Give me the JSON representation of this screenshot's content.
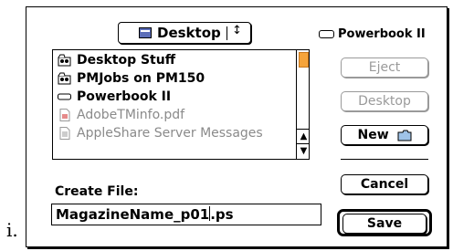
{
  "prefix": "i.",
  "location_popup": {
    "label": "Desktop",
    "arrow": "↕",
    "icon": "desktop-icon"
  },
  "volume": {
    "label": "Powerbook II",
    "icon": "disk-icon"
  },
  "file_list": {
    "items": [
      {
        "label": "Desktop Stuff",
        "icon": "shared-folder-icon",
        "enabled": true
      },
      {
        "label": "PMJobs on PM150",
        "icon": "shared-folder-icon",
        "enabled": true
      },
      {
        "label": "Powerbook II",
        "icon": "disk-icon",
        "enabled": true
      },
      {
        "label": "AdobeTMinfo.pdf",
        "icon": "pdf-document-icon",
        "enabled": false
      },
      {
        "label": "AppleShare Server Messages",
        "icon": "document-icon",
        "enabled": false
      }
    ]
  },
  "buttons": {
    "eject": "Eject",
    "desktop": "Desktop",
    "new": "New",
    "cancel": "Cancel",
    "save": "Save"
  },
  "create_file": {
    "label": "Create File:",
    "value_before_caret": "MagazineName_p01",
    "value_after_caret": ".ps"
  },
  "colors": {
    "scroll_thumb": "#f6a43b",
    "desktop_icon": "#5b6db8"
  }
}
